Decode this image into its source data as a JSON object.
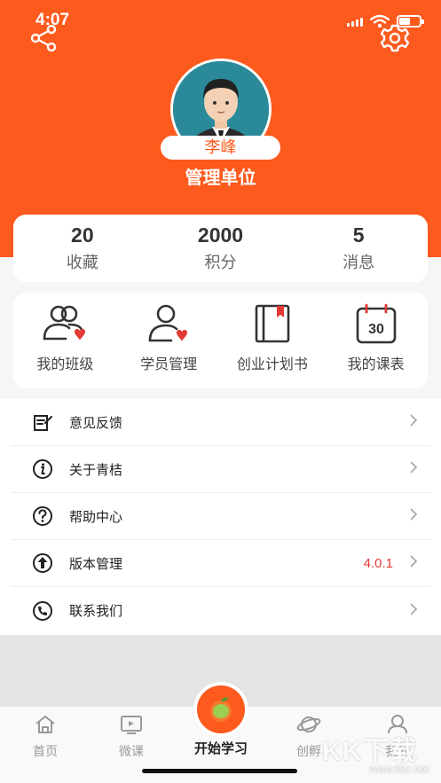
{
  "status_bar": {
    "time": "4:07"
  },
  "profile": {
    "name": "李峰",
    "organization": "管理单位"
  },
  "stats": [
    {
      "value": "20",
      "label": "收藏"
    },
    {
      "value": "2000",
      "label": "积分"
    },
    {
      "value": "5",
      "label": "消息"
    }
  ],
  "features": [
    {
      "label": "我的班级",
      "icon": "class-group-icon"
    },
    {
      "label": "学员管理",
      "icon": "student-management-icon"
    },
    {
      "label": "创业计划书",
      "icon": "business-plan-book-icon"
    },
    {
      "label": "我的课表",
      "icon": "calendar-schedule-icon",
      "calendar_day": "30"
    }
  ],
  "menu": [
    {
      "label": "意见反馈",
      "icon": "feedback-icon",
      "value": ""
    },
    {
      "label": "关于青桔",
      "icon": "info-icon",
      "value": ""
    },
    {
      "label": "帮助中心",
      "icon": "help-icon",
      "value": ""
    },
    {
      "label": "版本管理",
      "icon": "upgrade-icon",
      "value": "4.0.1"
    },
    {
      "label": "联系我们",
      "icon": "phone-icon",
      "value": ""
    }
  ],
  "tabbar": {
    "tabs": [
      {
        "label": "首页",
        "icon": "home-icon"
      },
      {
        "label": "微课",
        "icon": "micro-course-icon"
      },
      {
        "label": "创孵",
        "icon": "planet-icon"
      },
      {
        "label": "我的",
        "icon": "profile-icon"
      }
    ],
    "center": {
      "label": "开始学习",
      "icon": "orange-fruit-icon"
    }
  },
  "watermark": {
    "text": "KK下载",
    "url": "www.kkx.net"
  },
  "colors": {
    "accent": "#fd5a1e",
    "version_red": "#e53935"
  }
}
